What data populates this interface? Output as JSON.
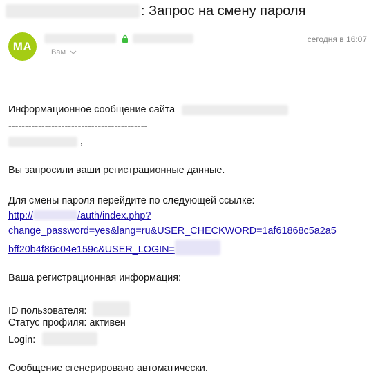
{
  "subject": {
    "title": ": Запрос на смену пароля"
  },
  "sender": {
    "avatar_initials": "MA",
    "to_label": "Вам",
    "date": "сегодня в 16:07"
  },
  "message": {
    "intro": "Информационное сообщение сайта",
    "divider": "------------------------------------------",
    "greeting_suffix": ",",
    "requested": "Вы запросили ваши регистрационные данные.",
    "change_prompt": "Для смены пароля перейдите по следующей ссылке:",
    "link_line1_prefix": "http://",
    "link_line1_suffix": "/auth/index.php?",
    "link_line2": "change_password=yes&lang=ru&USER_CHECKWORD=1af61868c5a2a5",
    "link_line3_prefix": "bff20b4f86c04e159c&USER_LOGIN=",
    "reg_info": "Ваша регистрационная информация:",
    "user_id_label": "ID пользователя:",
    "status_label": "Статус профиля: активен",
    "login_label": "Login:",
    "auto_generated": "Сообщение сгенерировано автоматически."
  }
}
